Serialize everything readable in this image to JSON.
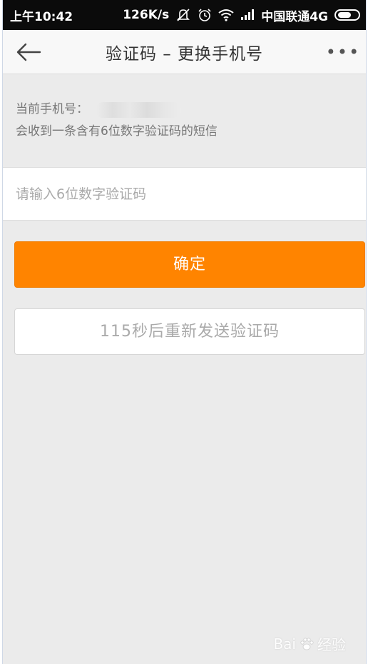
{
  "status_bar": {
    "time": "上午10:42",
    "speed": "126K/s",
    "carrier": "中国联通4G"
  },
  "nav": {
    "title": "验证码 – 更换手机号",
    "more": "•••"
  },
  "info": {
    "phone_label": "当前手机号：",
    "hint": "会收到一条含有6位数字验证码的短信"
  },
  "input": {
    "placeholder": "请输入6位数字验证码",
    "value": ""
  },
  "buttons": {
    "confirm": "确定",
    "resend": "115秒后重新发送验证码"
  },
  "watermark": {
    "text": "Bai",
    "suffix": "经验"
  },
  "colors": {
    "accent": "#ff8400",
    "background": "#ebebeb",
    "statusbar": "#0b0b0b"
  }
}
